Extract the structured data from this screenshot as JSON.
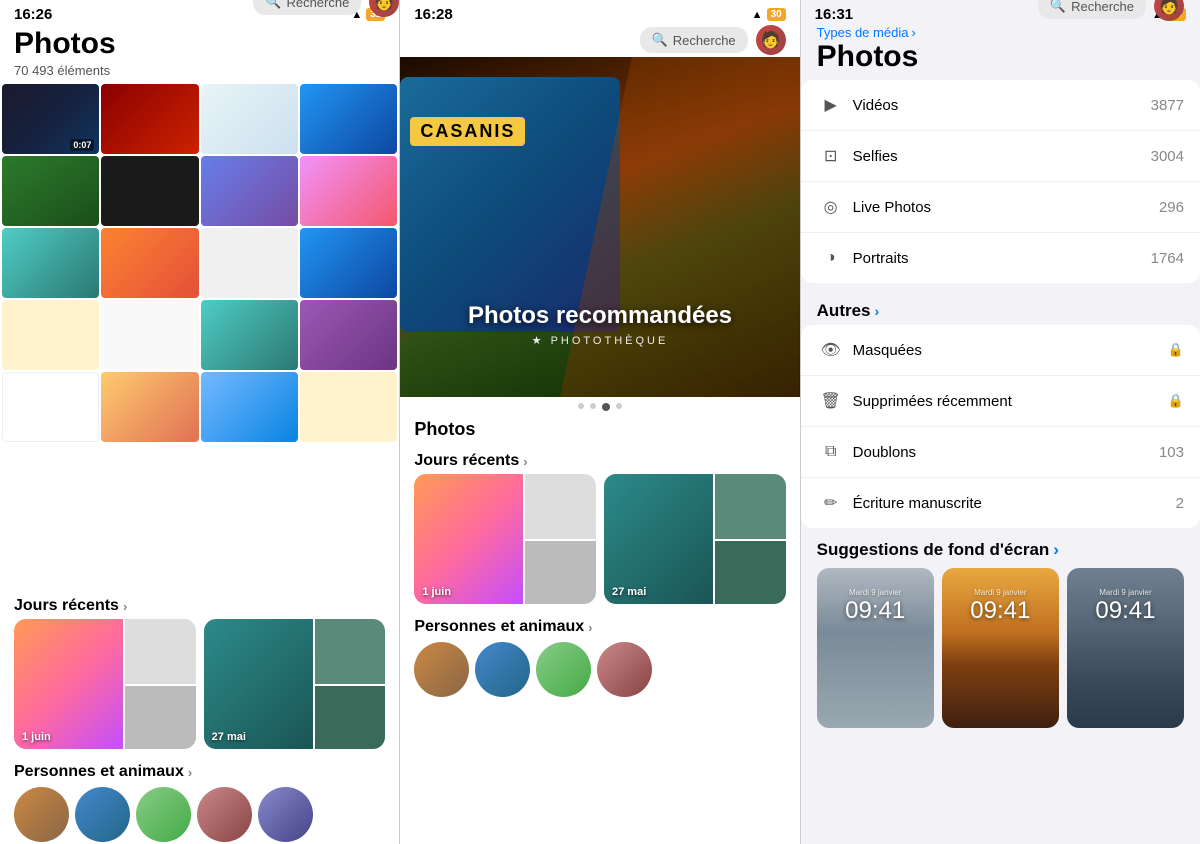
{
  "panel1": {
    "status": {
      "time": "16:26",
      "wifi": "WiFi",
      "battery": "31"
    },
    "title": "Photos",
    "subtitle": "70 493 éléments",
    "search": "Recherche",
    "sections": {
      "recent_days": "Jours récents",
      "people": "Personnes et animaux"
    },
    "days": [
      {
        "label": "1 juin"
      },
      {
        "label": "27 mai"
      }
    ]
  },
  "panel2": {
    "status": {
      "time": "16:28",
      "wifi": "WiFi",
      "battery": "30"
    },
    "search": "Recherche",
    "title": "Photos",
    "hero": {
      "title": "Photos recommandées",
      "subtitle": "PHOTOTHÈQUE",
      "label": "CASANIS"
    },
    "sections": {
      "recent_days": "Jours récents",
      "people": "Personnes et animaux"
    },
    "days": [
      {
        "label": "1 juin"
      },
      {
        "label": "27 mai"
      }
    ]
  },
  "panel3": {
    "status": {
      "time": "16:31",
      "wifi": "WiFi",
      "battery": "29"
    },
    "breadcrumb": "Types de média",
    "title": "Photos",
    "search": "Recherche",
    "media_types": [
      {
        "icon": "video",
        "label": "Vidéos",
        "count": "3877"
      },
      {
        "icon": "selfie",
        "label": "Selfies",
        "count": "3004"
      },
      {
        "icon": "livephoto",
        "label": "Live Photos",
        "count": "296"
      },
      {
        "icon": "portrait",
        "label": "Portraits",
        "count": "1764"
      }
    ],
    "autres_title": "Autres",
    "autres_items": [
      {
        "icon": "hidden",
        "label": "Masquées",
        "lock": true,
        "count": ""
      },
      {
        "icon": "trash",
        "label": "Supprimées récemment",
        "lock": true,
        "count": ""
      },
      {
        "icon": "duplicate",
        "label": "Doublons",
        "count": "103"
      },
      {
        "icon": "pen",
        "label": "Écriture manuscrite",
        "count": "2"
      }
    ],
    "wallpaper_title": "Suggestions de fond d'écran",
    "wallpapers": [
      {
        "date": "Mardi 9 janvier",
        "time": "09:41"
      },
      {
        "date": "Mardi 9 janvier",
        "time": "09:41"
      },
      {
        "date": "Mardi 9 janvier",
        "time": "09:41"
      }
    ]
  }
}
